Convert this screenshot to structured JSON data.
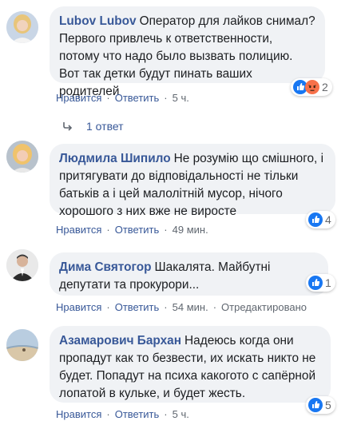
{
  "comments": [
    {
      "author": "Lubov Lubov",
      "text": "Оператор для лайков снимал? Первого привлечь к ответственности, потому что надо было вызвать полицию. Вот так детки будут пинать ваших родителей",
      "reaction_count": "2",
      "like_label": "Нравится",
      "reply_label": "Ответить",
      "time": "5 ч."
    },
    {
      "author": "Людмила Шипило",
      "text": "Не розумію що смішного, і притягувати до відповідальності не тільки батьків а і цей малолітній мусор, нічого хорошого з них вже не виросте",
      "reaction_count": "4",
      "like_label": "Нравится",
      "reply_label": "Ответить",
      "time": "49 мин."
    },
    {
      "author": "Дима Святогор",
      "text": "Шакалята. Майбутні депутати та прокурори...",
      "reaction_count": "1",
      "like_label": "Нравится",
      "reply_label": "Ответить",
      "time": "54 мин.",
      "edited": "Отредактировано"
    },
    {
      "author": "Азамарович Бархан",
      "text": "Надеюсь когда они пропадут как то безвести, их искать никто не будет. Попадут на психа какогото с сапёрной лопатой в кульке, и будет жесть.",
      "reaction_count": "5",
      "like_label": "Нравится",
      "reply_label": "Ответить",
      "time": "5 ч."
    }
  ],
  "replies": {
    "label": "1 ответ"
  },
  "colors": {
    "author": "#385898",
    "bubble": "#f0f2f5",
    "like_blue": "#1877f2",
    "angry_orange": "#f7714a",
    "meta_gray": "#606770"
  },
  "icons": [
    "like-icon",
    "angry-icon",
    "reply-arrow-icon"
  ]
}
